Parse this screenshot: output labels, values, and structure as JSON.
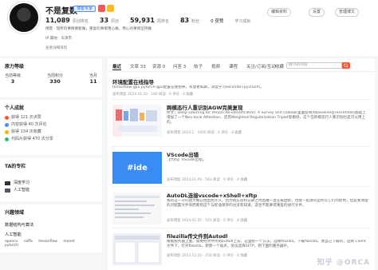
{
  "profile": {
    "username": "不是复数",
    "vip_label": "博客专家",
    "stats": [
      {
        "num": "11,089",
        "label": "原创排名"
      },
      {
        "num": "33",
        "label": "原创"
      },
      {
        "num": "59,931",
        "label": "周排名"
      },
      {
        "num": "83",
        "label": "粉丝"
      }
    ],
    "extra": "0 获赞",
    "study": "学习成就",
    "intro": "博客 · 现所的事情要能做，重复的事情用心做，用心的事情坚持做",
    "location": "IP 属地：天津市",
    "more": "查看详细资料",
    "edit_button": "编辑资料",
    "settings_button": "设置",
    "manage_button": "管理博文"
  },
  "sidebar": {
    "rank_title": "原力等级",
    "rank": [
      {
        "value": "3",
        "label": "当前等级"
      },
      {
        "value": "330",
        "label": "当前积分"
      },
      {
        "value": "11",
        "label": "当月"
      }
    ],
    "ach_title": "个人成就",
    "achievements": [
      {
        "text": "获得 121 次点赞",
        "color": "#fc5531"
      },
      {
        "text": "内容获得 40 次评论",
        "color": "#4f8cf7"
      },
      {
        "text": "获得 134 次收藏",
        "color": "#f7b500"
      },
      {
        "text": "代码片获得 470 次分享",
        "color": "#2ac27e"
      }
    ],
    "col_title": "TA的专栏",
    "columns": [
      "深度学习",
      "人工智能"
    ],
    "interest_title": "兴趣领域",
    "interest_sub": "数据结构与算法",
    "ai_title": "人工智能",
    "tags": [
      "opencv",
      "caffe",
      "tensorflow",
      "mxnet",
      "pytorch"
    ]
  },
  "tabs": [
    "最近",
    "文章",
    "资源",
    "问答",
    "帖子",
    "视频",
    "课程",
    "关注/订阅/互动",
    "收藏"
  ],
  "tab_counts": [
    "",
    "33",
    "0",
    "3",
    "",
    "",
    "",
    "",
    ""
  ],
  "search_placeholder": "搜TA的内容",
  "articles": [
    {
      "title": "环境配置在线指导",
      "summary": "tensorflow-gpu pytorch-gpu配置在线指导，有意者私聊。深度学习seconda+pycharm。",
      "meta": "发布博客 2024.01.10 · 190 阅读 · 0 评论 · 4 收藏"
    },
    {
      "title": "跨模态行人重识别AGW完美复现",
      "summary": "原文：Deep Learning for Person Re-identification: A Survey and Outlook里面提到的baseline在resnet50的基础上增加了一个Non-local Attention、还有Weighted Regularization Triplet等模块，这个在跨模态行人重识别也是可以用上的。",
      "meta": "发布博客 2024.1 · 1000 阅读 · 0 评论 · 4 收藏"
    },
    {
      "title": "VScode出错",
      "summary": "【代码】VScode出错。",
      "meta": "发布博客 2024.01.09 · 583 阅读 · 0 评论 · 4 收藏",
      "thumb_text": "#ide"
    },
    {
      "title": "AutoDL连接vscode+xShell+xftp",
      "summary": "我的这一次问题大概已经困扰许久，因为跑实验和记录之时困难一直在被困扰，也能一起放的是所以它们的使用，但是要清楚的对配置文件夹而看到这个与标准保存的也没有知道，适合不能要得重复的进行文件。",
      "meta": "发布博客 2024.01.05 · 541 阅读 · 0 评论 · 4 收藏"
    },
    {
      "title": "filezilla传文件到Autodl",
      "summary": "根据服务器上面，需要把文件传到autodl上去，这里统一个方法，选择filezilla。下载filezilla，我自己下载的，选择 Client 文件下，打开filezilla，新建一个站点，协议选择SFTP，把下面的服务器IP。",
      "meta": "发布博客 2023.12.20 · 250 阅读 · 0 评论 · 4 收藏"
    }
  ],
  "watermark": "知乎 @ORCA"
}
